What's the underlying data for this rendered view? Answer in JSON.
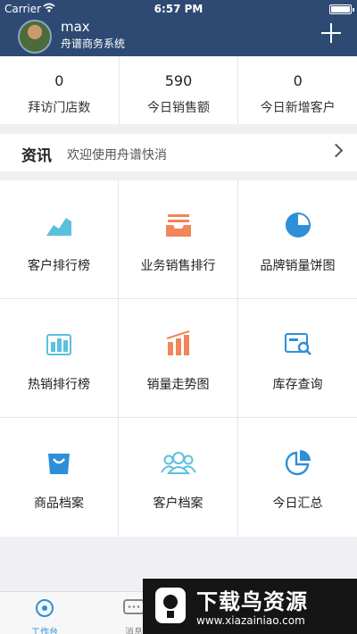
{
  "status_bar": {
    "carrier": "Carrier",
    "time": "6:57 PM"
  },
  "header": {
    "user_name": "max",
    "company": "舟谱商务系统"
  },
  "stats": [
    {
      "value": "0",
      "label": "拜访门店数"
    },
    {
      "value": "590",
      "label": "今日销售额"
    },
    {
      "value": "0",
      "label": "今日新增客户"
    }
  ],
  "news": {
    "title": "资讯",
    "text": "欢迎使用舟谱快消"
  },
  "grid": [
    {
      "label": "客户排行榜",
      "icon": "area-chart-icon",
      "color": "#5bc0de"
    },
    {
      "label": "业务销售排行",
      "icon": "tray-list-icon",
      "color": "#f0865a"
    },
    {
      "label": "品牌销量饼图",
      "icon": "pie-chart-icon",
      "color": "#2d8fd8"
    },
    {
      "label": "热销排行榜",
      "icon": "hot-ranking-icon",
      "color": "#5bc0de"
    },
    {
      "label": "销量走势图",
      "icon": "trend-chart-icon",
      "color": "#f0865a"
    },
    {
      "label": "库存查询",
      "icon": "stock-search-icon",
      "color": "#2d8fd8"
    },
    {
      "label": "商品档案",
      "icon": "shopping-bag-icon",
      "color": "#2d8fd8"
    },
    {
      "label": "客户档案",
      "icon": "customers-icon",
      "color": "#5bc0de"
    },
    {
      "label": "今日汇总",
      "icon": "summary-pie-icon",
      "color": "#2d8fd8"
    }
  ],
  "tabbar": {
    "work": "工作台",
    "msg": "消息"
  },
  "watermark": {
    "title": "下载鸟资源",
    "url": "www.xiazainiao.com"
  },
  "colors": {
    "header_bg": "#2e4a73",
    "accent": "#2d8fd8",
    "orange": "#f0865a",
    "teal": "#5bc0de"
  }
}
